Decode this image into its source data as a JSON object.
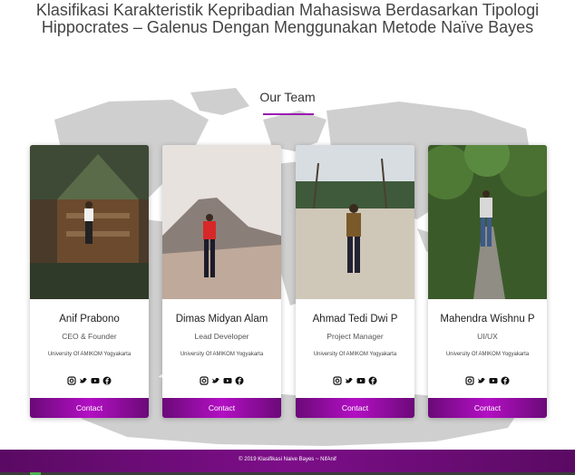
{
  "page": {
    "title": "Klasifikasi Karakteristik Kepribadian Mahasiswa Berdasarkan Tipologi Hippocrates – Galenus Dengan Menggunakan Metode Naïve Bayes",
    "title_line1": "Klasifikasi Karakteristik Kepribadian Mahasiswa Berdasarkan Tipologi",
    "title_line2": "Hippocrates – Galenus Dengan Menggunakan Metode Naïve Bayes"
  },
  "team": {
    "heading": "Our Team",
    "accent_color": "#9b1ab1",
    "members": [
      {
        "name": "Anif Prabono",
        "role": "CEO & Founder",
        "school": "University Of AMIKOM Yogyakarta",
        "contact_label": "Contact"
      },
      {
        "name": "Dimas Midyan Alam",
        "role": "Lead Developer",
        "school": "University Of AMIKOM Yogyakarta",
        "contact_label": "Contact"
      },
      {
        "name": "Ahmad Tedi Dwi P",
        "role": "Project Manager",
        "school": "University Of AMIKOM Yogyakarta",
        "contact_label": "Contact"
      },
      {
        "name": "Mahendra Wishnu P",
        "role": "UI/UX",
        "school": "University Of AMIKOM Yogyakarta",
        "contact_label": "Contact"
      }
    ],
    "social_icons": [
      "instagram-icon",
      "twitter-icon",
      "youtube-icon",
      "facebook-icon"
    ]
  },
  "footer": {
    "text": "© 2019 Klasifikasi Naive Bayes ~ NifAnif",
    "color": "#6b0a78"
  }
}
